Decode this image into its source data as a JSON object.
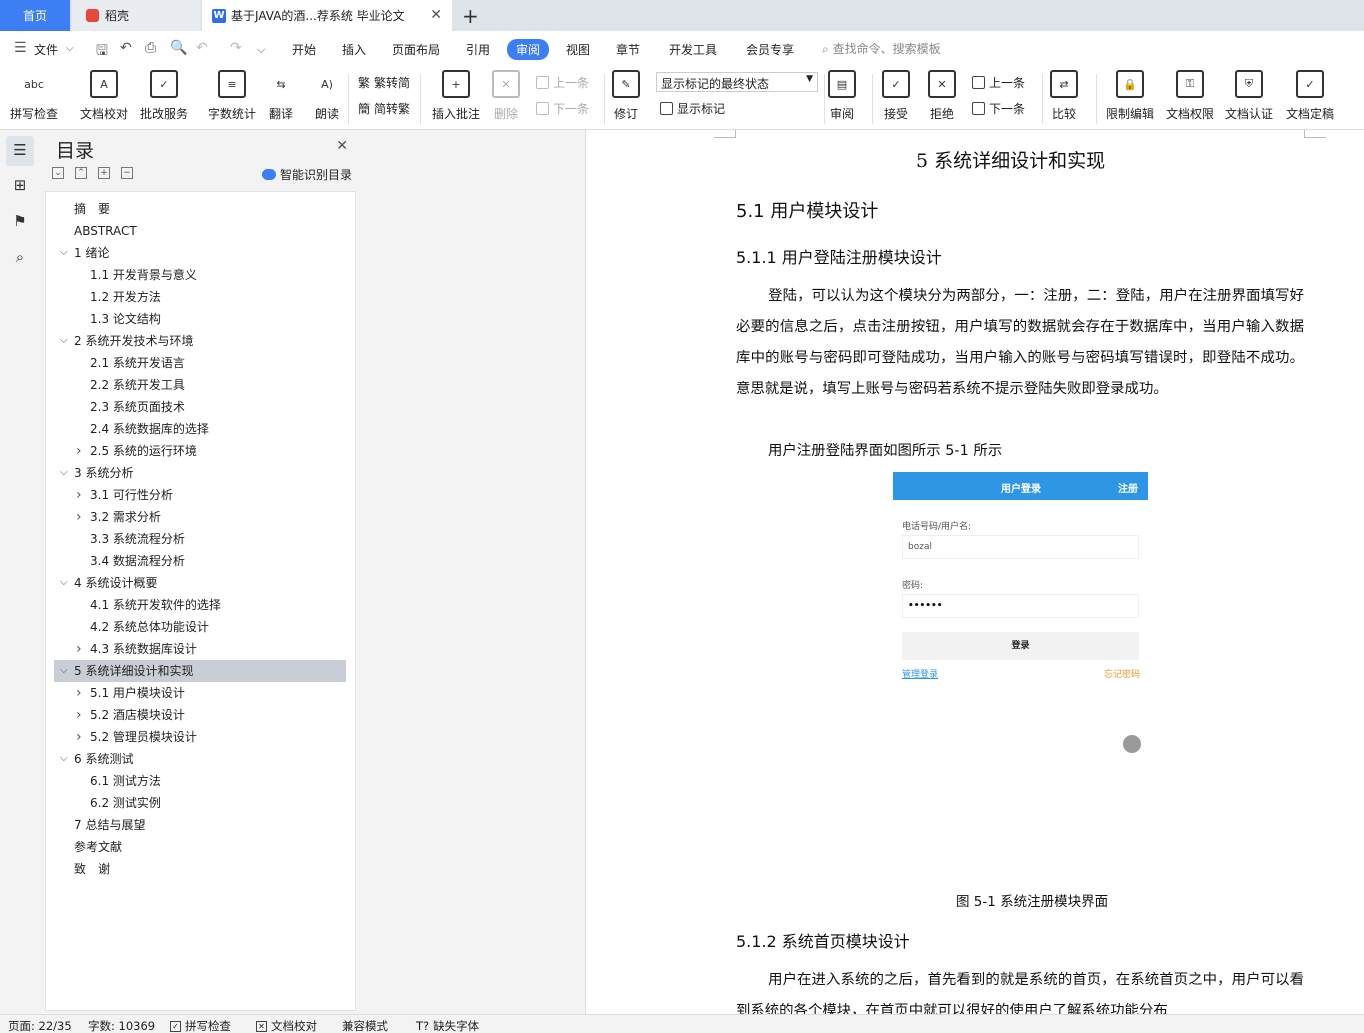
{
  "tabs": {
    "home": "首页",
    "straw": "稻壳",
    "doc": "基于JAVA的酒...荐系统 毕业论文",
    "doc_icon": "W"
  },
  "menu": {
    "file": "文件",
    "items": [
      "开始",
      "插入",
      "页面布局",
      "引用",
      "审阅",
      "视图",
      "章节",
      "开发工具",
      "会员专享"
    ],
    "active": "审阅",
    "search": "查找命令、搜索模板"
  },
  "ribbon": {
    "spell": "拼写检查",
    "spell_icon_text": "abc",
    "proofread": "文档校对",
    "batch": "批改服务",
    "wordcount": "字数统计",
    "translate": "翻译",
    "read": "朗读",
    "trad": "繁转简",
    "simp": "简转繁",
    "insert_comment": "插入批注",
    "delete": "删除",
    "prev": "上一条",
    "next": "下一条",
    "revise": "修订",
    "display_state": "显示标记的最终状态",
    "show_marks": "显示标记",
    "review": "审阅",
    "accept": "接受",
    "reject": "拒绝",
    "prev2": "上一条",
    "next2": "下一条",
    "compare": "比较",
    "restrict": "限制编辑",
    "permission": "文档权限",
    "certify": "文档认证",
    "finalize": "文档定稿"
  },
  "toc": {
    "title": "目录",
    "smart": "智能识别目录",
    "items": [
      {
        "label": "摘　要",
        "level": 0,
        "chev": ""
      },
      {
        "label": "ABSTRACT",
        "level": 0,
        "chev": ""
      },
      {
        "label": "1 绪论",
        "level": 0,
        "chev": "v"
      },
      {
        "label": "1.1 开发背景与意义",
        "level": 1,
        "chev": ""
      },
      {
        "label": "1.2 开发方法",
        "level": 1,
        "chev": ""
      },
      {
        "label": "1.3 论文结构",
        "level": 1,
        "chev": ""
      },
      {
        "label": "2 系统开发技术与环境",
        "level": 0,
        "chev": "v"
      },
      {
        "label": "2.1  系统开发语言",
        "level": 1,
        "chev": ""
      },
      {
        "label": "2.2  系统开发工具",
        "level": 1,
        "chev": ""
      },
      {
        "label": "2.3  系统页面技术",
        "level": 1,
        "chev": ""
      },
      {
        "label": "2.4  系统数据库的选择",
        "level": 1,
        "chev": ""
      },
      {
        "label": "2.5  系统的运行环境",
        "level": 1,
        "chev": ">"
      },
      {
        "label": "3  系统分析",
        "level": 0,
        "chev": "v"
      },
      {
        "label": "3.1 可行性分析",
        "level": 1,
        "chev": ">"
      },
      {
        "label": "3.2 需求分析",
        "level": 1,
        "chev": ">"
      },
      {
        "label": "3.3 系统流程分析",
        "level": 1,
        "chev": ""
      },
      {
        "label": "3.4 数据流程分析",
        "level": 1,
        "chev": ""
      },
      {
        "label": "4  系统设计概要",
        "level": 0,
        "chev": "v"
      },
      {
        "label": "4.1  系统开发软件的选择",
        "level": 1,
        "chev": ""
      },
      {
        "label": "4.2  系统总体功能设计",
        "level": 1,
        "chev": ""
      },
      {
        "label": "4.3  系统数据库设计",
        "level": 1,
        "chev": ">"
      },
      {
        "label": "5  系统详细设计和实现",
        "level": 0,
        "chev": "v",
        "selected": true
      },
      {
        "label": "5.1  用户模块设计",
        "level": 1,
        "chev": ">"
      },
      {
        "label": "5.2  酒店模块设计",
        "level": 1,
        "chev": ">"
      },
      {
        "label": "5.2  管理员模块设计",
        "level": 1,
        "chev": ">"
      },
      {
        "label": "6  系统测试",
        "level": 0,
        "chev": "v"
      },
      {
        "label": "6.1  测试方法",
        "level": 1,
        "chev": ""
      },
      {
        "label": "6.2  测试实例",
        "level": 1,
        "chev": ""
      },
      {
        "label": "7 总结与展望",
        "level": 0,
        "chev": ""
      },
      {
        "label": "参考文献",
        "level": 0,
        "chev": ""
      },
      {
        "label": "致　谢",
        "level": 0,
        "chev": ""
      }
    ]
  },
  "document": {
    "chapter": "5  系统详细设计和实现",
    "h2": "5.1  用户模块设计",
    "h3a": "5.1.1  用户登陆注册模块设计",
    "p1": "登陆，可以认为这个模块分为两部分，一：注册，二：登陆，用户在注册界面填写好必要的信息之后，点击注册按钮，用户填写的数据就会存在于数据库中，当用户输入数据库中的账号与密码即可登陆成功，当用户输入的账号与密码填写错误时，即登陆不成功。意思就是说，填写上账号与密码若系统不提示登陆失败即登录成功。",
    "p2": "用户注册登陆界面如图所示 5-1 所示",
    "caption": "图 5-1  系统注册模块界面",
    "h3b": "5.1.2  系统首页模块设计",
    "p3": "用户在进入系统的之后，首先看到的就是系统的首页，在系统首页之中，用户可以看到系统的各个模块，在首页中就可以很好的使用户了解系统功能分布",
    "login": {
      "title": "用户登录",
      "register": "注册",
      "user_label": "电话号码/用户名:",
      "user_value": "bozal",
      "pwd_label": "密码:",
      "pwd_value": "••••••",
      "button": "登录",
      "admin_link": "管理登录",
      "forgot_link": "忘记密码"
    }
  },
  "status": {
    "page": "页面: 22/35",
    "words": "字数: 10369",
    "spell": "拼写检查",
    "proof": "文档校对",
    "compat": "兼容模式",
    "missing_font": "缺失字体"
  }
}
